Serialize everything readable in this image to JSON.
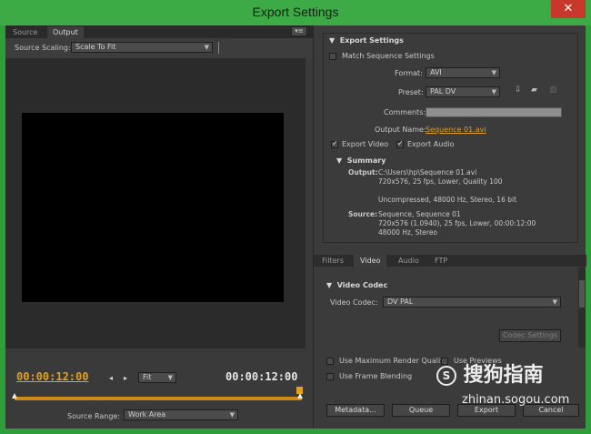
{
  "window": {
    "title": "Export Settings",
    "close_glyph": "✕"
  },
  "left": {
    "tabs": [
      "Source",
      "Output"
    ],
    "panel_menu_glyph": "▾≡",
    "source_scaling_label": "Source Scaling:",
    "source_scaling_value": "Scale To Fit",
    "timecode_in": "00:00:12:00",
    "timecode_out": "00:00:12:00",
    "zoom_value": "Fit",
    "source_range_label": "Source Range:",
    "source_range_value": "Work Area"
  },
  "export_settings": {
    "header": "Export Settings",
    "match_sequence": "Match Sequence Settings",
    "format_label": "Format:",
    "format_value": "AVI",
    "preset_label": "Preset:",
    "preset_value": "PAL DV",
    "comments_label": "Comments:",
    "output_name_label": "Output Name:",
    "output_name_value": "Sequence 01.avi",
    "export_video": "Export Video",
    "export_audio": "Export Audio",
    "summary_header": "Summary",
    "output_label": "Output:",
    "output_lines": [
      "C:\\Users\\hp\\Sequence 01.avi",
      "720x576, 25 fps, Lower, Quality 100",
      "",
      "Uncompressed, 48000 Hz, Stereo, 16 bit"
    ],
    "source_label": "Source:",
    "source_lines": [
      "Sequence, Sequence 01",
      "720x576 (1.0940), 25 fps, Lower, 00:00:12:00",
      "48000 Hz, Stereo"
    ]
  },
  "right_tabs": [
    "Filters",
    "Video",
    "Audio",
    "FTP"
  ],
  "video_codec": {
    "header": "Video Codec",
    "codec_label": "Video Codec:",
    "codec_value": "DV PAL",
    "codec_settings": "Codec Settings"
  },
  "options": {
    "max_render_quality": "Use Maximum Render Quality",
    "use_previews": "Use Previews",
    "frame_blending": "Use Frame Blending"
  },
  "buttons": {
    "metadata": "Metadata...",
    "queue": "Queue",
    "export": "Export",
    "cancel": "Cancel"
  },
  "watermark": {
    "brand": "搜狗指南",
    "url": "zhinan.sogou.com"
  }
}
